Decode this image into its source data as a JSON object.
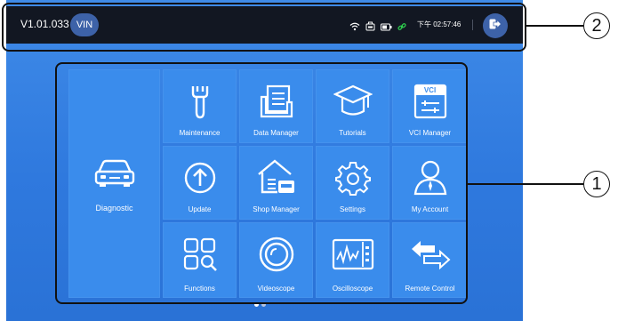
{
  "status_bar": {
    "version": "V1.01.033",
    "vin_label": "VIN",
    "time": "下午 02:57:46",
    "icons": [
      "wifi-icon",
      "vci-link-icon",
      "battery-icon",
      "link-icon"
    ]
  },
  "tiles": {
    "diagnostic": "Diagnostic",
    "maintenance": "Maintenance",
    "data_manager": "Data Manager",
    "tutorials": "Tutorials",
    "vci_manager": "VCI Manager",
    "vci_badge": "VCI",
    "update": "Update",
    "shop_manager": "Shop Manager",
    "settings": "Settings",
    "my_account": "My Account",
    "functions": "Functions",
    "videoscope": "Videoscope",
    "oscilloscope": "Oscilloscope",
    "remote_control": "Remote Control"
  },
  "pager": {
    "pages": 2,
    "active": 1
  },
  "callouts": {
    "top": "2",
    "grid": "1"
  },
  "colors": {
    "status_bar": "#121722",
    "background": "#2f79de",
    "tile": "#3a8cec",
    "accent": "#3d62a8"
  }
}
